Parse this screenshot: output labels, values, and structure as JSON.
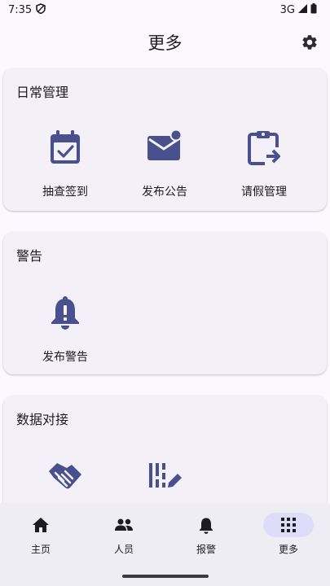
{
  "status": {
    "time": "7:35",
    "network": "3G"
  },
  "header": {
    "title": "更多"
  },
  "sections": {
    "daily": {
      "title": "日常管理",
      "items": [
        {
          "label": "抽查签到",
          "icon": "calendar-check-icon"
        },
        {
          "label": "发布公告",
          "icon": "mail-badge-icon"
        },
        {
          "label": "请假管理",
          "icon": "clipboard-arrow-icon"
        }
      ]
    },
    "alert": {
      "title": "警告",
      "items": [
        {
          "label": "发布警告",
          "icon": "bell-alert-icon"
        }
      ]
    },
    "data": {
      "title": "数据对接",
      "items": [
        {
          "label": "",
          "icon": "handshake-icon"
        },
        {
          "label": "",
          "icon": "signature-icon"
        }
      ]
    }
  },
  "nav": {
    "items": [
      {
        "label": "主页",
        "icon": "home-icon"
      },
      {
        "label": "人员",
        "icon": "people-icon"
      },
      {
        "label": "报警",
        "icon": "bell-icon"
      },
      {
        "label": "更多",
        "icon": "grid-icon",
        "active": true
      }
    ]
  },
  "colors": {
    "accent": "#4a4f8e",
    "background": "#fbf8fe",
    "card": "#f3f1f7",
    "nav_background": "#efedf4",
    "active_pill": "#dedcf8"
  }
}
